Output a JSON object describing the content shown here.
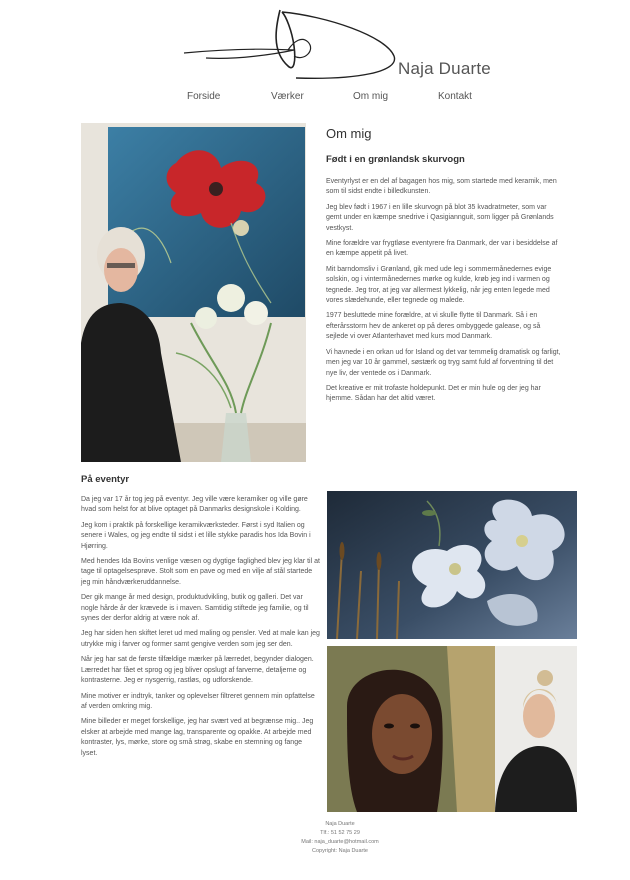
{
  "brand": {
    "name": "Naja Duarte"
  },
  "nav": {
    "items": [
      "Forside",
      "Værker",
      "Om mig",
      "Kontakt"
    ]
  },
  "about": {
    "title": "Om mig",
    "subtitle": "Født i en grønlandsk skurvogn",
    "paragraphs": [
      "Eventyrlyst er en del af bagagen hos mig, som startede med keramik, men som til sidst endte i billedkunsten.",
      "Jeg blev født i 1967 i en lille skurvogn på blot 35 kvadratmeter, som var gemt under en kæmpe snedrive i Qasigiannguit, som ligger på Grønlands vestkyst.",
      "Mine forældre var frygtløse eventyrere fra Danmark, der var i besiddelse af en kæmpe appetit på livet.",
      "Mit barndomsliv i Grønland, gik med ude leg i sommermånedernes evige solskin, og i vintermånedernes mørke og kulde, krøb jeg ind i varmen og tegnede. Jeg tror, at jeg var allermest lykkelig, når jeg enten legede med vores slædehunde, eller tegnede og malede.",
      "1977 besluttede mine forældre, at vi skulle flytte til Danmark. Så i en efterårsstorm hev de ankeret op på deres ombyggede galease, og så sejlede vi over Atlanterhavet med kurs mod Danmark.",
      "Vi havnede i en orkan ud for Island og det var temmelig dramatisk og farligt, men jeg var 10 år gammel, søstærk og tryg samt fuld af forventning til det nye liv, der ventede os i Danmark.",
      "Det kreative er mit trofaste holdepunkt. Det er min hule og der jeg har hjemme. Sådan har det altid været."
    ]
  },
  "adventure": {
    "title": "På eventyr",
    "paragraphs": [
      "Da jeg var 17 år tog jeg på eventyr. Jeg ville være keramiker og ville gøre hvad som helst for at blive optaget på Danmarks designskole i Kolding.",
      "Jeg kom i praktik på forskellige keramikværksteder. Først i syd Italien og senere i Wales, og jeg endte til sidst i et lille stykke paradis hos Ida Bovin i Hjørring.",
      "Med hendes Ida Bovins venlige væsen og dygtige faglighed blev jeg klar til at tage til optagelsesprøve. Stolt som en pave og med en vilje af stål startede jeg min håndværkeruddannelse.",
      "Der gik mange år med design, produktudvikling, butik og galleri. Det var nogle hårde år der krævede is i maven. Samtidig stiftede jeg familie, og til synes der derfor aldrig at være nok af.",
      "Jeg har siden hen skiftet leret ud med maling og pensler. Ved at male kan jeg utrykke mig i farver og former samt gengive verden som jeg ser den.",
      "Når jeg har sat de første tilfældige mærker på lærredet, begynder dialogen. Lærredet har fået et sprog og jeg bliver opslugt af farverne, detaljerne og kontrasterne. Jeg er nysgerrig, rastløs, og udforskende.",
      "Mine motiver er indtryk, tanker og oplevelser filtreret gennem min opfattelse af verden omkring mig.",
      "Mine billeder er meget forskellige, jeg har svært ved at begrænse mig.. Jeg elsker at arbejde med mange lag, transparente og opakke. At arbejde med kontraster, lys, mørke, store og små strøg, skabe en stemning og fange lyset."
    ]
  },
  "footer": {
    "lines": [
      "Naja Duarte",
      "Tlf.: 51 52 75 29",
      "Mail: naja_duarte@hotmail.com",
      "Copyright: Naja Duarte"
    ]
  },
  "colors": {
    "text": "#555555",
    "heading": "#333333",
    "background": "#ffffff"
  }
}
